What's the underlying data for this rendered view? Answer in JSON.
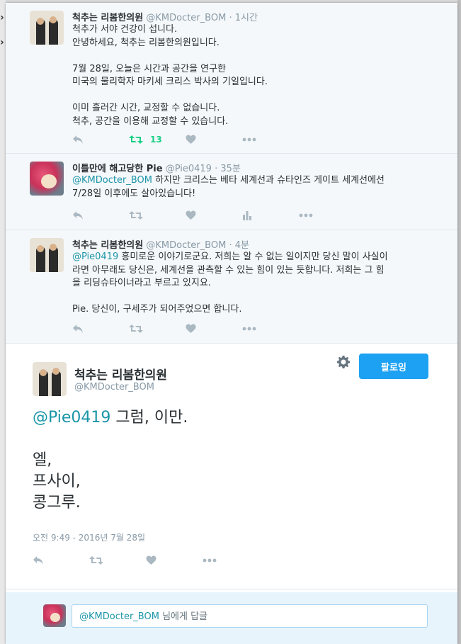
{
  "tweets": [
    {
      "name": "척추는 리봄한의원",
      "handle": "@KMDocter_BOM",
      "separator": "·",
      "time": "1시간",
      "body": "척추가 서야 건강이 섭니다.\n안녕하세요, 척추는 리봄한의원입니다.\n\n7월 28일, 오늘은 시간과 공간을 연구한\n미국의 물리학자 마키세 크리스 박사의 기일입니다.\n\n이미 흘러간 시간, 교정할 수 없습니다.\n척추, 공간을 이용해 교정할 수 있습니다.",
      "retweet_count": "13"
    },
    {
      "name": "이틀만에 해고당한 Pie",
      "handle": "@Pie0419",
      "separator": "·",
      "time": "35분",
      "mention": "@KMDocter_BOM",
      "body": " 하지만 크리스는 베타 세계선과 슈타인즈 게이트 세계선에선\n7/28일 이후에도 살아있습니다!"
    },
    {
      "name": "척추는 리봄한의원",
      "handle": "@KMDocter_BOM",
      "separator": "·",
      "time": "4분",
      "mention": "@Pie0419",
      "body": " 흥미로운 이야기로군요. 저희는 알 수 없는 일이지만 당신 말이 사실이\n라면 아무래도 당신은, 세계선을 관측할 수 있는 힘이 있는 듯합니다. 저희는 그 힘\n을 리딩슈타이너라고 부르고 있지요.\n\nPie. 당신이, 구세주가 되어주었으면 합니다."
    }
  ],
  "permalink": {
    "name": "척추는 리봄한의원",
    "handle": "@KMDocter_BOM",
    "follow_label": "팔로잉",
    "mention": "@Pie0419",
    "text_rest": " 그럼, 이만.\n\n엘,\n프사이,\n콩그루.",
    "timestamp": "오전 9:49 - 2016년 7월 28일"
  },
  "reply": {
    "handle": "@KMDocter_BOM",
    "suffix": " 님에게 답글"
  },
  "colors": {
    "accent": "#1da1f2",
    "mention": "#1b95a8",
    "retweet_active": "#19cf86",
    "muted": "#8899a6"
  },
  "icons": [
    "reply-icon",
    "retweet-icon",
    "like-icon",
    "analytics-icon",
    "more-icon",
    "gear-icon"
  ]
}
